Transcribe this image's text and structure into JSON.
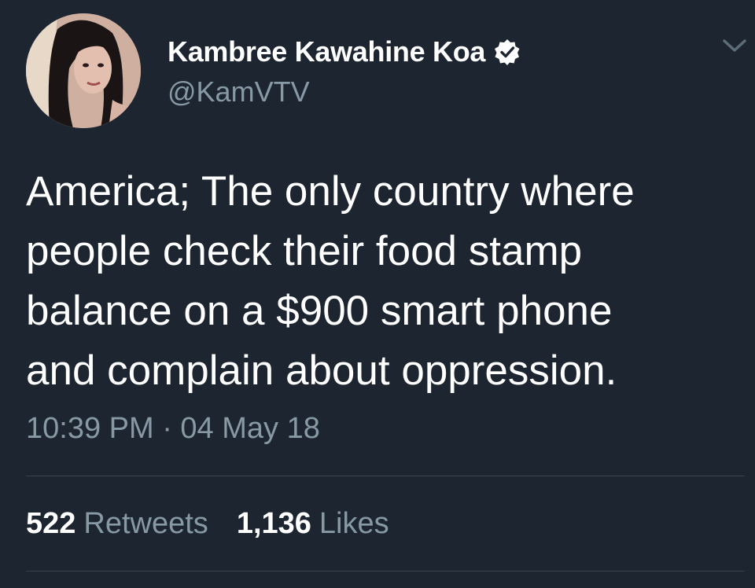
{
  "author": {
    "display_name": "Kambree Kawahine Koa",
    "handle": "@KamVTV",
    "verified": true,
    "avatar_icon": "profile-photo"
  },
  "tweet": {
    "text": "America; The only country where\npeople check their food stamp\nbalance on a $900 smart phone\nand complain about oppression.",
    "timestamp": "10:39 PM · 04 May 18"
  },
  "stats": {
    "retweets_count": "522",
    "retweets_label": "Retweets",
    "likes_count": "1,136",
    "likes_label": "Likes"
  },
  "colors": {
    "background": "#1c2530",
    "primary_text": "#ffffff",
    "secondary_text": "#8899a6",
    "divider": "#38444d"
  }
}
